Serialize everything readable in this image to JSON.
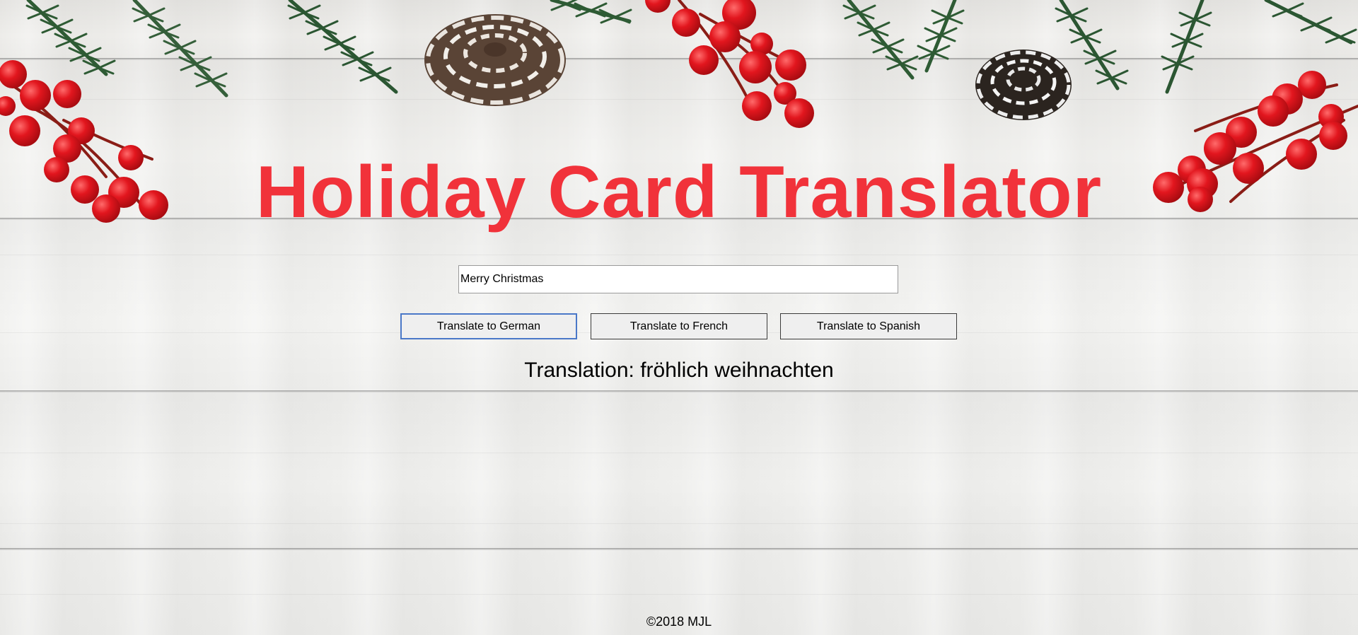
{
  "page": {
    "title": "Holiday Card Translator"
  },
  "form": {
    "input_value": "Merry Christmas"
  },
  "buttons": {
    "german": "Translate to German",
    "french": "Translate to French",
    "spanish": "Translate to Spanish"
  },
  "result": {
    "text": "Translation: fröhlich weihnachten"
  },
  "footer": {
    "text": "©2018 MJL"
  },
  "colors": {
    "title": "#f1323a",
    "berry": "#d8141c",
    "pine": "#2e5b34",
    "focus_ring": "#4a78c8"
  },
  "decor": {
    "background": "white-wood-planks",
    "ornaments": [
      "pine-branches",
      "red-berries",
      "pine-cones"
    ]
  }
}
